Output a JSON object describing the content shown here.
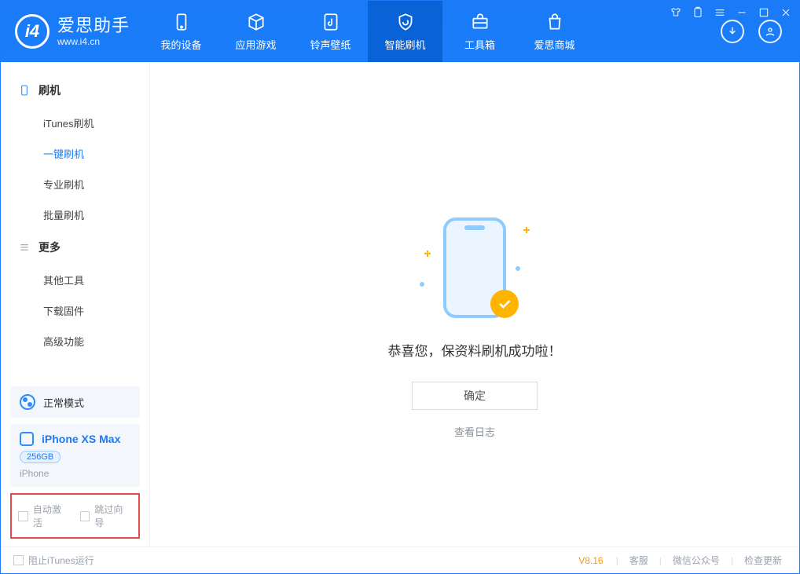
{
  "brand": {
    "name": "爱思助手",
    "url": "www.i4.cn"
  },
  "tabs": [
    {
      "id": "device",
      "label": "我的设备"
    },
    {
      "id": "apps",
      "label": "应用游戏"
    },
    {
      "id": "ring",
      "label": "铃声壁纸"
    },
    {
      "id": "flash",
      "label": "智能刷机"
    },
    {
      "id": "tools",
      "label": "工具箱"
    },
    {
      "id": "mall",
      "label": "爱思商城"
    }
  ],
  "sidebar": {
    "group1_title": "刷机",
    "items1": [
      "iTunes刷机",
      "一键刷机",
      "专业刷机",
      "批量刷机"
    ],
    "group2_title": "更多",
    "items2": [
      "其他工具",
      "下载固件",
      "高级功能"
    ]
  },
  "mode": {
    "label": "正常模式"
  },
  "device": {
    "name": "iPhone XS Max",
    "cap": "256GB",
    "kind": "iPhone"
  },
  "options": {
    "auto_activate": "自动激活",
    "skip_guide": "跳过向导"
  },
  "main": {
    "success_msg": "恭喜您，保资料刷机成功啦！",
    "ok": "确定",
    "view_log": "查看日志"
  },
  "footer": {
    "block_itunes": "阻止iTunes运行",
    "version": "V8.16",
    "links": [
      "客服",
      "微信公众号",
      "检查更新"
    ]
  }
}
